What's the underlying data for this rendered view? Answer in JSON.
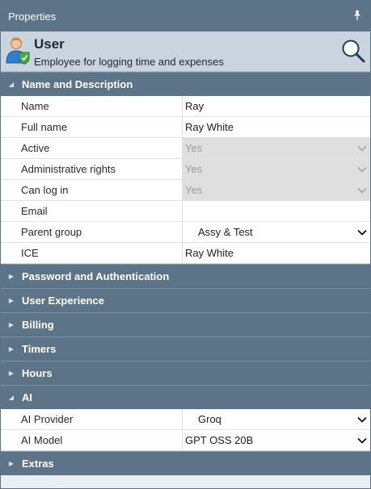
{
  "titlebar": {
    "title": "Properties",
    "pin_icon": "pin-icon"
  },
  "header": {
    "object_name": "User",
    "object_description": "Employee for logging time and expenses",
    "user_icon": "user-shield-icon",
    "search_icon": "search-icon"
  },
  "categories": {
    "name_description": "Name and Description",
    "password": "Password and Authentication",
    "user_experience": "User Experience",
    "billing": "Billing",
    "timers": "Timers",
    "hours": "Hours",
    "ai": "AI",
    "extras": "Extras"
  },
  "fields": {
    "name": {
      "label": "Name",
      "value": "Ray"
    },
    "full_name": {
      "label": "Full name",
      "value": "Ray White"
    },
    "active": {
      "label": "Active",
      "value": "Yes"
    },
    "admin_rights": {
      "label": "Administrative rights",
      "value": "Yes"
    },
    "can_log_in": {
      "label": "Can log in",
      "value": "Yes"
    },
    "email": {
      "label": "Email",
      "value": ""
    },
    "parent_group": {
      "label": "Parent group",
      "value": "Assy & Test"
    },
    "ice": {
      "label": "ICE",
      "value": "Ray White"
    },
    "ai_provider": {
      "label": "AI Provider",
      "value": "Groq"
    },
    "ai_model": {
      "label": "AI Model",
      "value": "GPT OSS 20B"
    }
  },
  "colors": {
    "panel": "#5d7488",
    "header": "#c9d4de",
    "background": "#ebeef2",
    "disabled": "#dfdfdf"
  }
}
